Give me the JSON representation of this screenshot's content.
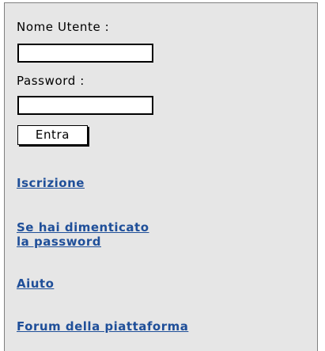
{
  "login": {
    "username_label": "Nome Utente :",
    "username_value": "",
    "password_label": "Password :",
    "password_value": "",
    "submit_label": "Entra"
  },
  "links": {
    "register": "Iscrizione",
    "forgot_line1": "Se hai dimenticato",
    "forgot_line2": "la password",
    "help": "Aiuto",
    "forum": "Forum della piattaforma"
  },
  "colors": {
    "panel_background": "#e6e6e6",
    "link": "#1f4f99"
  }
}
